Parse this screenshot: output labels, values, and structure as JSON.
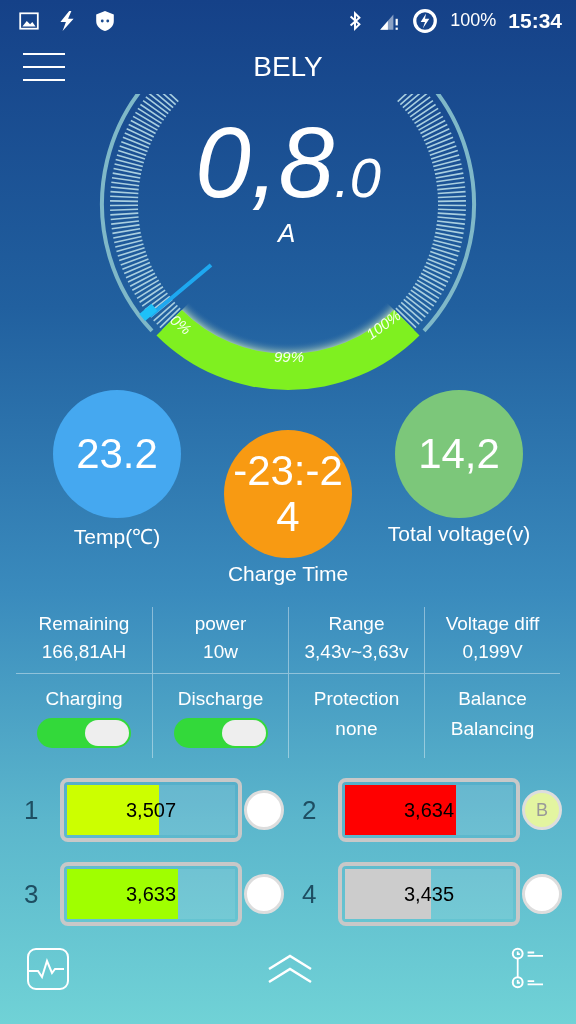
{
  "status_bar": {
    "battery": "100%",
    "time": "15:34"
  },
  "app_bar": {
    "title": "BELY"
  },
  "gauge": {
    "value": "0,8",
    "decimal": ".0",
    "unit": "A",
    "scale_labels": [
      "0%",
      "99%",
      "100%"
    ]
  },
  "circles": [
    {
      "value": "23.2",
      "label": "Temp(℃)",
      "color": "#45a8f0"
    },
    {
      "value": "-23:-24",
      "label": "Charge Time",
      "color": "#f89a12"
    },
    {
      "value": "14,2",
      "label": "Total voltage(v)",
      "color": "#7cc77a"
    }
  ],
  "stats": [
    {
      "label": "Remaining",
      "value": "166,81AH"
    },
    {
      "label": "power",
      "value": "10w"
    },
    {
      "label": "Range",
      "value": "3,43v~3,63v"
    },
    {
      "label": "Voltage diff",
      "value": "0,199V"
    }
  ],
  "controls": [
    {
      "kind": "switch",
      "label": "Charging",
      "on": true
    },
    {
      "kind": "switch",
      "label": "Discharge",
      "on": true
    },
    {
      "kind": "text",
      "label": "Protection",
      "value": "none"
    },
    {
      "kind": "text",
      "label": "Balance",
      "value": "Balancing"
    }
  ],
  "cells": [
    {
      "number": "1",
      "value": "3,507",
      "level": 0.55,
      "color": "#ccff00",
      "balancing": false
    },
    {
      "number": "2",
      "value": "3,634",
      "level": 0.66,
      "color": "#ff0000",
      "balancing": true,
      "badge": "B"
    },
    {
      "number": "3",
      "value": "3,633",
      "level": 0.66,
      "color": "#a0ff00",
      "balancing": false
    },
    {
      "number": "4",
      "value": "3,435",
      "level": 0.51,
      "color": "#cccccc",
      "balancing": false
    }
  ]
}
